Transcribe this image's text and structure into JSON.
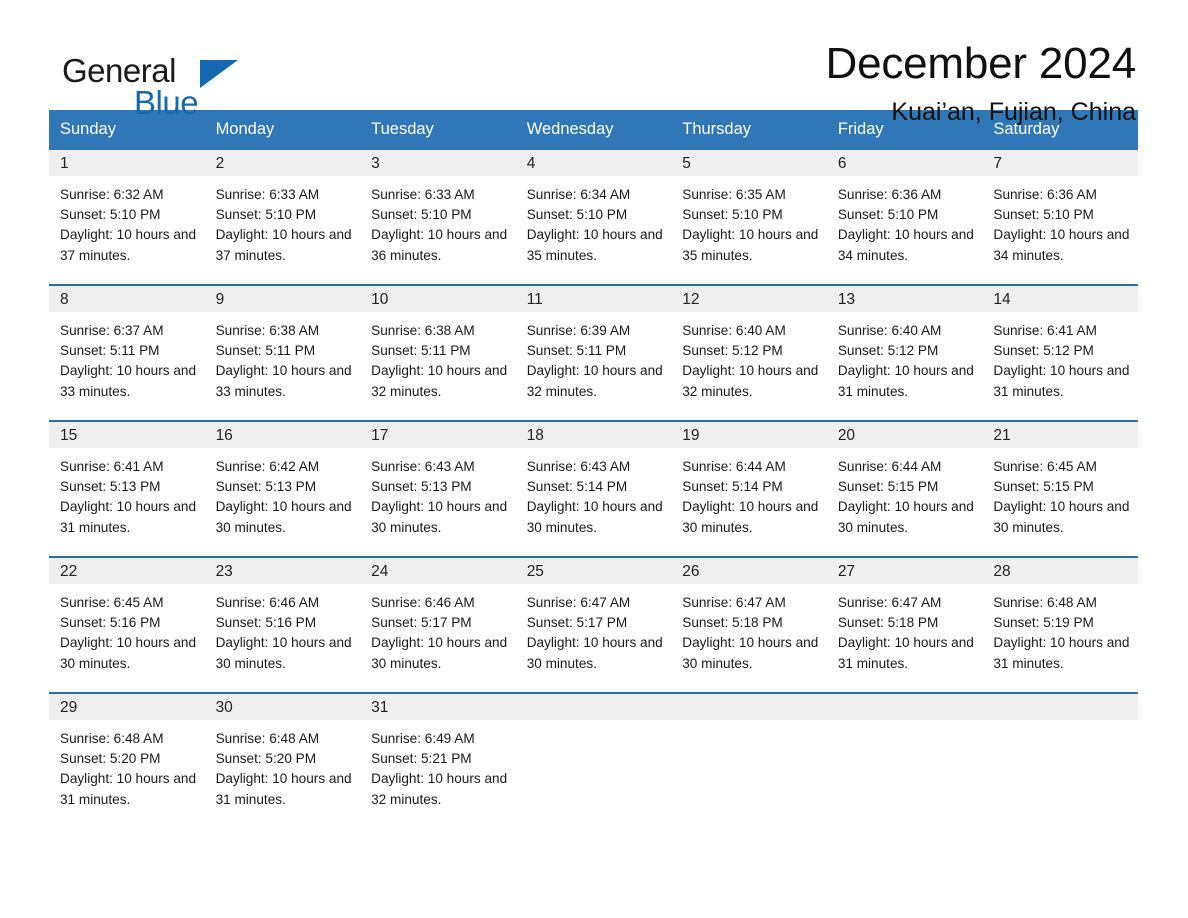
{
  "brand": {
    "name_part1": "General",
    "name_part2": "Blue",
    "triangle_color": "#1569b0"
  },
  "header": {
    "month_title": "December 2024",
    "location": "Kuai’an, Fujian, China",
    "accent_color": "#3077B8",
    "daynum_band_color": "#EFEFEF",
    "row_divider_color": "#2E6DA8"
  },
  "weekday_headers": [
    "Sunday",
    "Monday",
    "Tuesday",
    "Wednesday",
    "Thursday",
    "Friday",
    "Saturday"
  ],
  "weeks": [
    [
      {
        "day": "1",
        "info": "Sunrise: 6:32 AM\nSunset: 5:10 PM\nDaylight: 10 hours and 37 minutes."
      },
      {
        "day": "2",
        "info": "Sunrise: 6:33 AM\nSunset: 5:10 PM\nDaylight: 10 hours and 37 minutes."
      },
      {
        "day": "3",
        "info": "Sunrise: 6:33 AM\nSunset: 5:10 PM\nDaylight: 10 hours and 36 minutes."
      },
      {
        "day": "4",
        "info": "Sunrise: 6:34 AM\nSunset: 5:10 PM\nDaylight: 10 hours and 35 minutes."
      },
      {
        "day": "5",
        "info": "Sunrise: 6:35 AM\nSunset: 5:10 PM\nDaylight: 10 hours and 35 minutes."
      },
      {
        "day": "6",
        "info": "Sunrise: 6:36 AM\nSunset: 5:10 PM\nDaylight: 10 hours and 34 minutes."
      },
      {
        "day": "7",
        "info": "Sunrise: 6:36 AM\nSunset: 5:10 PM\nDaylight: 10 hours and 34 minutes."
      }
    ],
    [
      {
        "day": "8",
        "info": "Sunrise: 6:37 AM\nSunset: 5:11 PM\nDaylight: 10 hours and 33 minutes."
      },
      {
        "day": "9",
        "info": "Sunrise: 6:38 AM\nSunset: 5:11 PM\nDaylight: 10 hours and 33 minutes."
      },
      {
        "day": "10",
        "info": "Sunrise: 6:38 AM\nSunset: 5:11 PM\nDaylight: 10 hours and 32 minutes."
      },
      {
        "day": "11",
        "info": "Sunrise: 6:39 AM\nSunset: 5:11 PM\nDaylight: 10 hours and 32 minutes."
      },
      {
        "day": "12",
        "info": "Sunrise: 6:40 AM\nSunset: 5:12 PM\nDaylight: 10 hours and 32 minutes."
      },
      {
        "day": "13",
        "info": "Sunrise: 6:40 AM\nSunset: 5:12 PM\nDaylight: 10 hours and 31 minutes."
      },
      {
        "day": "14",
        "info": "Sunrise: 6:41 AM\nSunset: 5:12 PM\nDaylight: 10 hours and 31 minutes."
      }
    ],
    [
      {
        "day": "15",
        "info": "Sunrise: 6:41 AM\nSunset: 5:13 PM\nDaylight: 10 hours and 31 minutes."
      },
      {
        "day": "16",
        "info": "Sunrise: 6:42 AM\nSunset: 5:13 PM\nDaylight: 10 hours and 30 minutes."
      },
      {
        "day": "17",
        "info": "Sunrise: 6:43 AM\nSunset: 5:13 PM\nDaylight: 10 hours and 30 minutes."
      },
      {
        "day": "18",
        "info": "Sunrise: 6:43 AM\nSunset: 5:14 PM\nDaylight: 10 hours and 30 minutes."
      },
      {
        "day": "19",
        "info": "Sunrise: 6:44 AM\nSunset: 5:14 PM\nDaylight: 10 hours and 30 minutes."
      },
      {
        "day": "20",
        "info": "Sunrise: 6:44 AM\nSunset: 5:15 PM\nDaylight: 10 hours and 30 minutes."
      },
      {
        "day": "21",
        "info": "Sunrise: 6:45 AM\nSunset: 5:15 PM\nDaylight: 10 hours and 30 minutes."
      }
    ],
    [
      {
        "day": "22",
        "info": "Sunrise: 6:45 AM\nSunset: 5:16 PM\nDaylight: 10 hours and 30 minutes."
      },
      {
        "day": "23",
        "info": "Sunrise: 6:46 AM\nSunset: 5:16 PM\nDaylight: 10 hours and 30 minutes."
      },
      {
        "day": "24",
        "info": "Sunrise: 6:46 AM\nSunset: 5:17 PM\nDaylight: 10 hours and 30 minutes."
      },
      {
        "day": "25",
        "info": "Sunrise: 6:47 AM\nSunset: 5:17 PM\nDaylight: 10 hours and 30 minutes."
      },
      {
        "day": "26",
        "info": "Sunrise: 6:47 AM\nSunset: 5:18 PM\nDaylight: 10 hours and 30 minutes."
      },
      {
        "day": "27",
        "info": "Sunrise: 6:47 AM\nSunset: 5:18 PM\nDaylight: 10 hours and 31 minutes."
      },
      {
        "day": "28",
        "info": "Sunrise: 6:48 AM\nSunset: 5:19 PM\nDaylight: 10 hours and 31 minutes."
      }
    ],
    [
      {
        "day": "29",
        "info": "Sunrise: 6:48 AM\nSunset: 5:20 PM\nDaylight: 10 hours and 31 minutes."
      },
      {
        "day": "30",
        "info": "Sunrise: 6:48 AM\nSunset: 5:20 PM\nDaylight: 10 hours and 31 minutes."
      },
      {
        "day": "31",
        "info": "Sunrise: 6:49 AM\nSunset: 5:21 PM\nDaylight: 10 hours and 32 minutes."
      },
      {
        "day": "",
        "info": ""
      },
      {
        "day": "",
        "info": ""
      },
      {
        "day": "",
        "info": ""
      },
      {
        "day": "",
        "info": ""
      }
    ]
  ]
}
